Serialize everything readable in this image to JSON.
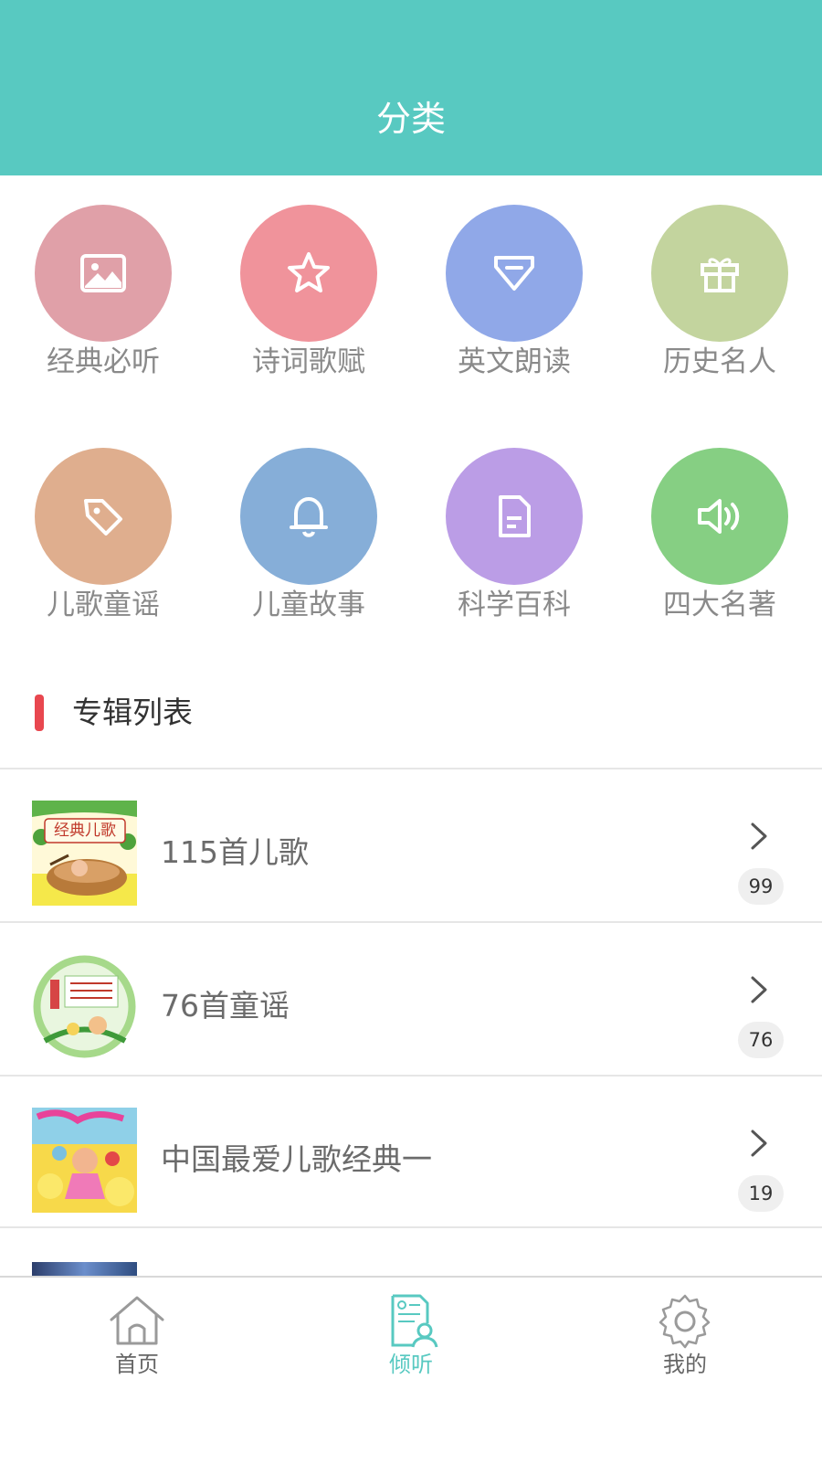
{
  "header": {
    "title": "分类"
  },
  "categories": [
    {
      "label": "经典必听",
      "icon": "image-icon",
      "color": "#e0a0a8"
    },
    {
      "label": "诗词歌赋",
      "icon": "star-icon",
      "color": "#f0939b"
    },
    {
      "label": "英文朗读",
      "icon": "gem-icon",
      "color": "#90a8e8"
    },
    {
      "label": "历史名人",
      "icon": "gift-icon",
      "color": "#c3d49e"
    },
    {
      "label": "儿歌童谣",
      "icon": "tag-icon",
      "color": "#dfae8e"
    },
    {
      "label": "儿童故事",
      "icon": "bell-icon",
      "color": "#86aed8"
    },
    {
      "label": "科学百科",
      "icon": "document-icon",
      "color": "#bb9de6"
    },
    {
      "label": "四大名著",
      "icon": "speaker-icon",
      "color": "#86cf83"
    }
  ],
  "section": {
    "title": "专辑列表",
    "accent": "#e8474f"
  },
  "albums": [
    {
      "title": "115首儿歌",
      "count": "99",
      "cover_text": "经典儿歌"
    },
    {
      "title": "76首童谣",
      "count": "76"
    },
    {
      "title": "中国最爱儿歌经典一",
      "count": "19"
    }
  ],
  "nav": [
    {
      "label": "首页",
      "icon": "home-icon",
      "active": false
    },
    {
      "label": "倾听",
      "icon": "listen-icon",
      "active": true
    },
    {
      "label": "我的",
      "icon": "settings-icon",
      "active": false
    }
  ],
  "colors": {
    "brand": "#58c9c1"
  }
}
